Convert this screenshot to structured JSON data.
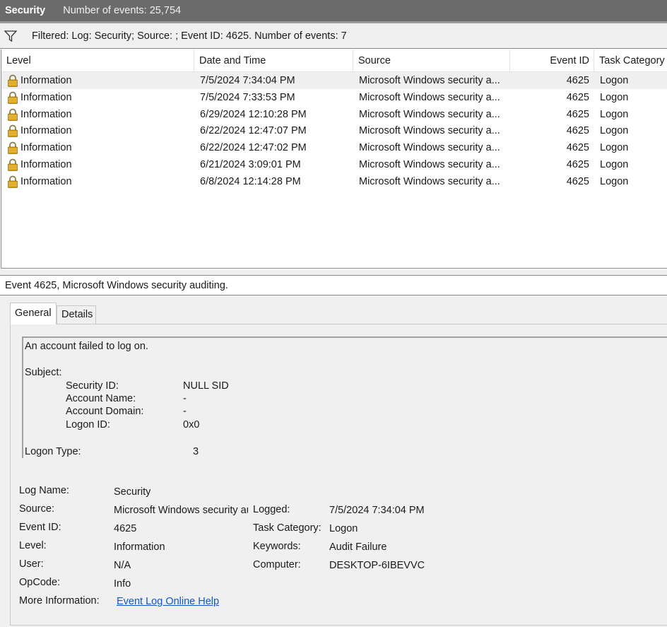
{
  "header": {
    "title": "Security",
    "count_text": "Number of events: 25,754"
  },
  "filter": {
    "icon": "filter-funnel-icon",
    "text": "Filtered: Log: Security; Source: ; Event ID: 4625. Number of events: 7"
  },
  "list": {
    "columns": [
      "Level",
      "Date and Time",
      "Source",
      "Event ID",
      "Task Category"
    ],
    "rows": [
      {
        "level": "Information",
        "date": "7/5/2024 7:34:04 PM",
        "source": "Microsoft Windows security a...",
        "event_id": "4625",
        "category": "Logon"
      },
      {
        "level": "Information",
        "date": "7/5/2024 7:33:53 PM",
        "source": "Microsoft Windows security a...",
        "event_id": "4625",
        "category": "Logon"
      },
      {
        "level": "Information",
        "date": "6/29/2024 12:10:28 PM",
        "source": "Microsoft Windows security a...",
        "event_id": "4625",
        "category": "Logon"
      },
      {
        "level": "Information",
        "date": "6/22/2024 12:47:07 PM",
        "source": "Microsoft Windows security a...",
        "event_id": "4625",
        "category": "Logon"
      },
      {
        "level": "Information",
        "date": "6/22/2024 12:47:02 PM",
        "source": "Microsoft Windows security a...",
        "event_id": "4625",
        "category": "Logon"
      },
      {
        "level": "Information",
        "date": "6/21/2024 3:09:01 PM",
        "source": "Microsoft Windows security a...",
        "event_id": "4625",
        "category": "Logon"
      },
      {
        "level": "Information",
        "date": "6/8/2024 12:14:28 PM",
        "source": "Microsoft Windows security a...",
        "event_id": "4625",
        "category": "Logon"
      }
    ]
  },
  "detail": {
    "title": "Event 4625, Microsoft Windows security auditing.",
    "tabs": [
      "General",
      "Details"
    ],
    "message": {
      "line1": "An account failed to log on.",
      "subject": "Subject:",
      "fields": [
        {
          "key": "Security ID:",
          "value": "NULL SID"
        },
        {
          "key": "Account Name:",
          "value": "-"
        },
        {
          "key": "Account Domain:",
          "value": "-"
        },
        {
          "key": "Logon ID:",
          "value": "0x0"
        }
      ],
      "logon_type_label": "Logon Type:",
      "logon_type_value": "3"
    },
    "props": {
      "log_name_label": "Log Name:",
      "log_name": "Security",
      "source_label": "Source:",
      "source": "Microsoft Windows security auditing.",
      "logged_label": "Logged:",
      "logged": "7/5/2024 7:34:04 PM",
      "event_id_label": "Event ID:",
      "event_id": "4625",
      "task_category_label": "Task Category:",
      "task_category": "Logon",
      "level_label": "Level:",
      "level": "Information",
      "keywords_label": "Keywords:",
      "keywords": "Audit Failure",
      "user_label": "User:",
      "user": "N/A",
      "computer_label": "Computer:",
      "computer": "DESKTOP-6IBEVVC",
      "opcode_label": "OpCode:",
      "opcode": "Info",
      "more_info_label": "More Information:",
      "more_info_link": "Event Log Online Help"
    }
  },
  "colors": {
    "header_bg": "#6b6b6b",
    "pane_bg": "#f0f0f0",
    "link": "#0a58d0",
    "lock_gold": "#d9a520"
  }
}
